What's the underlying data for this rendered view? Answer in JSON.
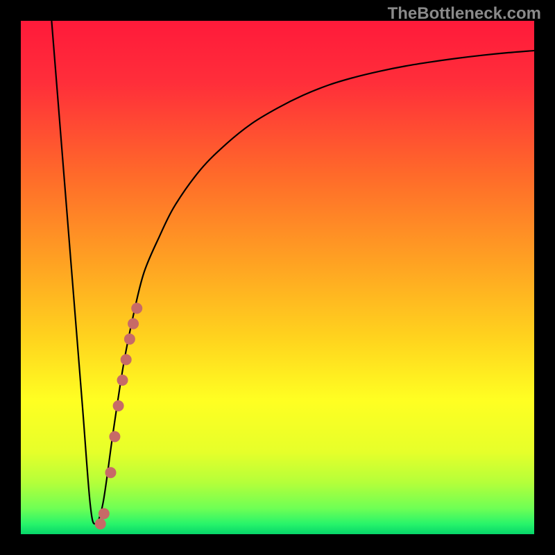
{
  "watermark": "TheBottleneck.com",
  "colors": {
    "background": "#000000",
    "gradient_stops": [
      {
        "offset": 0.0,
        "color": "#ff1a3a"
      },
      {
        "offset": 0.12,
        "color": "#ff2e3a"
      },
      {
        "offset": 0.3,
        "color": "#ff6a2a"
      },
      {
        "offset": 0.48,
        "color": "#ffa522"
      },
      {
        "offset": 0.62,
        "color": "#ffd41e"
      },
      {
        "offset": 0.74,
        "color": "#ffff22"
      },
      {
        "offset": 0.84,
        "color": "#e6ff2a"
      },
      {
        "offset": 0.9,
        "color": "#b4ff3a"
      },
      {
        "offset": 0.95,
        "color": "#6eff55"
      },
      {
        "offset": 0.98,
        "color": "#28f46a"
      },
      {
        "offset": 1.0,
        "color": "#06d66a"
      }
    ],
    "curve_stroke": "#000000",
    "dot_fill": "#c76a67",
    "watermark": "#8a8a8a"
  },
  "chart_data": {
    "type": "line",
    "title": "",
    "xlabel": "",
    "ylabel": "",
    "xlim": [
      0,
      100
    ],
    "ylim": [
      0,
      100
    ],
    "series": [
      {
        "name": "bottleneck-curve",
        "x": [
          6,
          8,
          10,
          12,
          13.5,
          14.5,
          16,
          18,
          20,
          22,
          24,
          27,
          30,
          35,
          40,
          45,
          50,
          55,
          60,
          65,
          70,
          75,
          80,
          85,
          90,
          95,
          100
        ],
        "y": [
          100,
          75,
          50,
          25,
          6,
          2,
          6,
          20,
          33,
          43,
          51,
          58,
          64,
          71,
          76,
          80,
          83,
          85.5,
          87.5,
          89,
          90.2,
          91.2,
          92,
          92.7,
          93.3,
          93.8,
          94.2
        ]
      }
    ],
    "scatter": {
      "name": "highlight-dots",
      "points": [
        {
          "x": 15.5,
          "y": 2
        },
        {
          "x": 16.2,
          "y": 4
        },
        {
          "x": 17.5,
          "y": 12
        },
        {
          "x": 18.3,
          "y": 19
        },
        {
          "x": 19.0,
          "y": 25
        },
        {
          "x": 19.8,
          "y": 30
        },
        {
          "x": 20.5,
          "y": 34
        },
        {
          "x": 21.2,
          "y": 38
        },
        {
          "x": 21.9,
          "y": 41
        },
        {
          "x": 22.6,
          "y": 44
        }
      ],
      "radius": 8
    }
  }
}
